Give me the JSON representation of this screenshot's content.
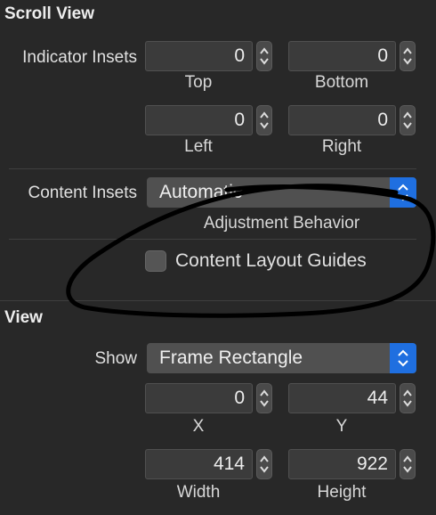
{
  "scroll_view": {
    "title": "Scroll View",
    "indicator_insets_label": "Indicator Insets",
    "top": {
      "value": "0",
      "label": "Top"
    },
    "bottom": {
      "value": "0",
      "label": "Bottom"
    },
    "left": {
      "value": "0",
      "label": "Left"
    },
    "right": {
      "value": "0",
      "label": "Right"
    },
    "content_insets_label": "Content Insets",
    "content_insets_value": "Automatic",
    "adjustment_behavior_label": "Adjustment Behavior",
    "content_layout_guides_label": "Content Layout Guides",
    "content_layout_guides_checked": false
  },
  "view": {
    "title": "View",
    "show_label": "Show",
    "show_value": "Frame Rectangle",
    "x": {
      "value": "0",
      "label": "X"
    },
    "y": {
      "value": "44",
      "label": "Y"
    },
    "width": {
      "value": "414",
      "label": "Width"
    },
    "height": {
      "value": "922",
      "label": "Height"
    }
  },
  "colors": {
    "background": "#282828",
    "accent": "#1f6fe0",
    "annotation_stroke": "#000000"
  },
  "icons": [
    "stepper-icon",
    "popup-arrows-icon",
    "checkbox-icon"
  ]
}
